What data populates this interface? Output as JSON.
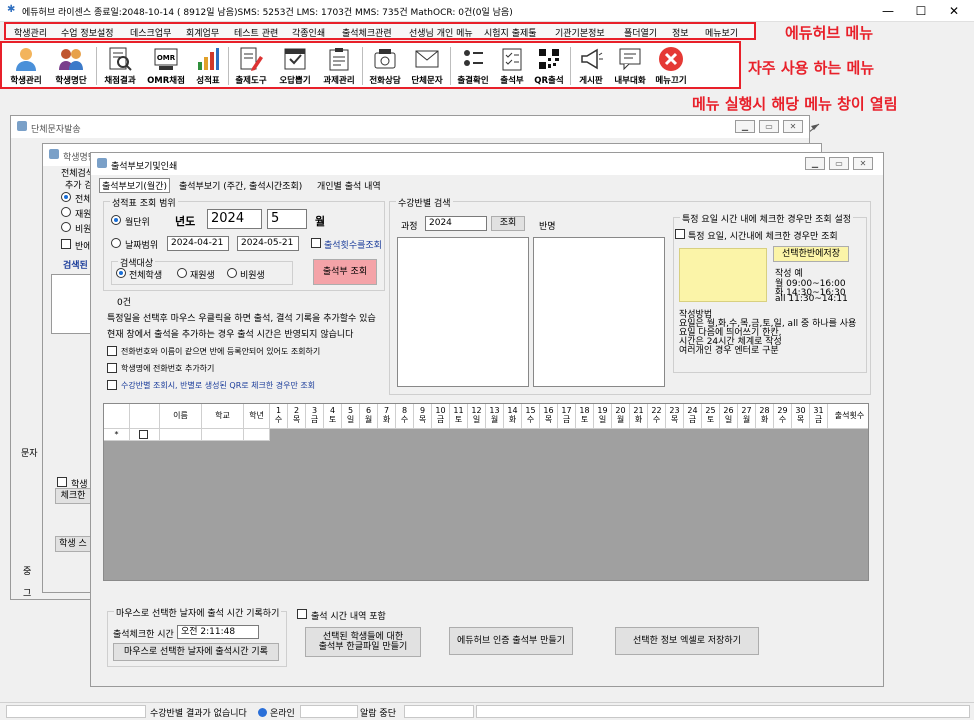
{
  "title": "에듀허브 라이센스 종료일:2048-10-14 ( 8912일 남음)SMS: 5253건 LMS: 1703건 MMS: 735건  MathOCR: 0건(0일 남음)",
  "menu": [
    "학생관리",
    "수업 정보설정",
    "데스크업무",
    "회계업무",
    "테스트 관련",
    "각종인쇄",
    "출석체크관련",
    "선생님 개인 메뉴",
    "시험지 출제툴",
    "기관기본정보",
    "폴더열기",
    "정보",
    "메뉴보기"
  ],
  "toolbar": [
    "학생관리",
    "학생명단",
    "채점결과",
    "OMR채점",
    "성적표",
    "출제도구",
    "오답뽑기",
    "과제관리",
    "전화상담",
    "단체문자",
    "출결확인",
    "출석부",
    "QR출석",
    "게시판",
    "내부대화",
    "메뉴끄기"
  ],
  "annotations": {
    "menu": "에듀허브 메뉴",
    "toolbar": "자주 사용 하는 메뉴",
    "window": "메뉴 실행시 해당 메뉴 창이 열림"
  },
  "bg_windows": {
    "w1_title": "단체문자발송",
    "w2_title": "학생명단",
    "w2_labels": [
      "전체검색",
      "추가 검",
      "전체",
      "재원",
      "비원",
      "반에",
      "검색된"
    ],
    "w1_labels": [
      "문자",
      "학생",
      "체크한",
      "학생 스",
      "중",
      "그"
    ]
  },
  "attendance": {
    "title": "출석부보기및인쇄",
    "tabs": [
      "출석부보기(월간)",
      "출석부보기 (주간, 출석시간조회)",
      "개인별 출석 내역"
    ],
    "range_group": "성적표 조회 범위",
    "monthly": "월단위",
    "year_label": "년도",
    "year": "2024",
    "month": "5",
    "month_label": "월",
    "date_range": "날짜범위",
    "date_from": "2024-04-21",
    "date_to": "2024-05-21",
    "count_query": "출석횟수를조회",
    "target_group": "검색대상",
    "target_all": "전체학생",
    "target_enrolled": "재원생",
    "target_nonenrolled": "비원생",
    "query_btn": "출석부 조회",
    "count": "0건",
    "info1": "특정일을 선택후 마우스 우클릭을 하면 출석, 결석 기록을 추가할수 있습",
    "info2": "현재 창에서 출석을 추가하는 경우 출석 시간은 반영되지 않습니다",
    "opt1": "전화번호와 이름이 같으면 반에 등록안되어 있어도 조회하기",
    "opt2": "학생명에 전화번호 추가하기",
    "opt3": "수강반별 조회시, 반별로 생성된 QR로 체크한 경우만 조회",
    "class_search": "수강반별 검색",
    "course_label": "과정",
    "course_value": "2024",
    "search_btn": "조회",
    "class_label": "반명",
    "weekday_group": "특정 요일 시간 내에 체크한 경우만 조회 설정",
    "weekday_chk": "특정 요일, 시간내에 체크한 경우만 조회",
    "save_class_btn": "선택한반에저장",
    "example_title": "작성 예",
    "example_lines": [
      "월 09:00~16:00",
      "화 14:30~16:30",
      "all 11:30~14:11"
    ],
    "method_lines": [
      "작성방법",
      "요일은 월,화,수,목,금,토,일, all 중 하나를 사용",
      "요일 다음에 띄어쓰기 한칸,",
      "시간은 24시간 체계로 작성",
      "여러개인 경우 엔터로 구분"
    ],
    "grid_headers": [
      "이름",
      "학교",
      "학년"
    ],
    "days": [
      "1\n수",
      "2\n목",
      "3\n금",
      "4\n토",
      "5\n일",
      "6\n월",
      "7\n화",
      "8\n수",
      "9\n목",
      "10\n금",
      "11\n토",
      "12\n일",
      "13\n월",
      "14\n화",
      "15\n수",
      "16\n목",
      "17\n금",
      "18\n토",
      "19\n일",
      "20\n월",
      "21\n화",
      "22\n수",
      "23\n목",
      "24\n금",
      "25\n토",
      "26\n일",
      "27\n월",
      "28\n화",
      "29\n수",
      "30\n목",
      "31\n금"
    ],
    "count_header": "출석횟수",
    "bottom_group": "마우스로 선택한 날자에 출석 시간 기록하기",
    "check_time_label": "출석체크한 시간",
    "check_time": "오전  2:11:48",
    "record_btn": "마우스로 선택한 날자에 출석시간 기록",
    "include_time": "출석 시간 내역 포함",
    "hwp_btn": "선택된 학생들에 대한\n출석부 한글파일 만들기",
    "cert_btn": "에듀허브 인증 출석부 만들기",
    "excel_btn": "선택한 정보 엑셀로 저장하기"
  },
  "status": {
    "class_result": "수강반별 결과가 없습니다",
    "online": "온라인",
    "alarm": "알람 중단"
  },
  "colors": {
    "red": "#e8202a",
    "query_btn": "#f4a3a8",
    "note_bg": "#fbf4a8"
  }
}
